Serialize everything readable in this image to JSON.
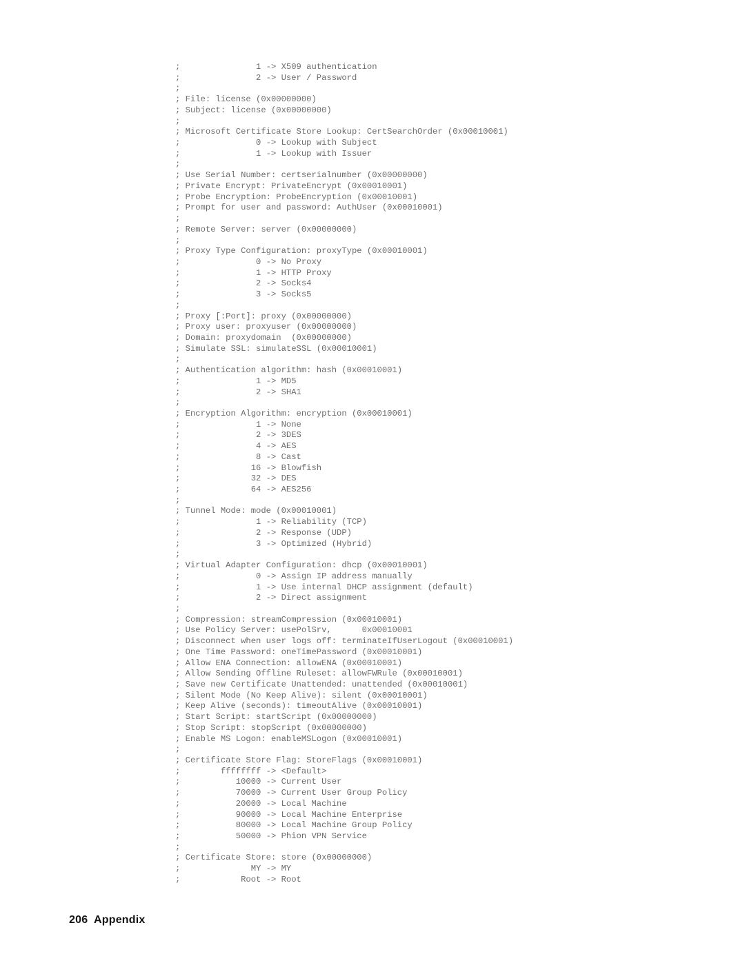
{
  "document": {
    "page_number": "206",
    "section_label": "Appendix",
    "footer_text": "206  Appendix",
    "text_color": "#6d6d6d",
    "footer_color": "#141414",
    "background_color": "#ffffff"
  },
  "listing": {
    "lines": [
      ";               1 -> X509 authentication",
      ";               2 -> User / Password",
      ";",
      "; File: license (0x00000000)",
      "; Subject: license (0x00000000)",
      ";",
      "; Microsoft Certificate Store Lookup: CertSearchOrder (0x00010001)",
      ";               0 -> Lookup with Subject",
      ";               1 -> Lookup with Issuer",
      ";",
      "; Use Serial Number: certserialnumber (0x00000000)",
      "; Private Encrypt: PrivateEncrypt (0x00010001)",
      "; Probe Encryption: ProbeEncryption (0x00010001)",
      "; Prompt for user and password: AuthUser (0x00010001)",
      ";",
      "; Remote Server: server (0x00000000)",
      ";",
      "; Proxy Type Configuration: proxyType (0x00010001)",
      ";               0 -> No Proxy",
      ";               1 -> HTTP Proxy",
      ";               2 -> Socks4",
      ";               3 -> Socks5",
      ";",
      "; Proxy [:Port]: proxy (0x00000000)",
      "; Proxy user: proxyuser (0x00000000)",
      "; Domain: proxydomain  (0x00000000)",
      "; Simulate SSL: simulateSSL (0x00010001)",
      ";",
      "; Authentication algorithm: hash (0x00010001)",
      ";               1 -> MD5",
      ";               2 -> SHA1",
      ";",
      "; Encryption Algorithm: encryption (0x00010001)",
      ";               1 -> None",
      ";               2 -> 3DES",
      ";               4 -> AES",
      ";               8 -> Cast",
      ";              16 -> Blowfish",
      ";              32 -> DES",
      ";              64 -> AES256",
      ";",
      "; Tunnel Mode: mode (0x00010001)",
      ";               1 -> Reliability (TCP)",
      ";               2 -> Response (UDP)",
      ";               3 -> Optimized (Hybrid)",
      ";",
      "; Virtual Adapter Configuration: dhcp (0x00010001)",
      ";               0 -> Assign IP address manually",
      ";               1 -> Use internal DHCP assignment (default)",
      ";               2 -> Direct assignment",
      ";",
      "; Compression: streamCompression (0x00010001)",
      "; Use Policy Server: usePolSrv,      0x00010001",
      "; Disconnect when user logs off: terminateIfUserLogout (0x00010001)",
      "; One Time Password: oneTimePassword (0x00010001)",
      "; Allow ENA Connection: allowENA (0x00010001)",
      "; Allow Sending Offline Ruleset: allowFWRule (0x00010001)",
      "; Save new Certificate Unattended: unattended (0x00010001)",
      "; Silent Mode (No Keep Alive): silent (0x00010001)",
      "; Keep Alive (seconds): timeoutAlive (0x00010001)",
      "; Start Script: startScript (0x00000000)",
      "; Stop Script: stopScript (0x00000000)",
      "; Enable MS Logon: enableMSLogon (0x00010001)",
      ";",
      "; Certificate Store Flag: StoreFlags (0x00010001)",
      ";        ffffffff -> <Default>",
      ";           10000 -> Current User",
      ";           70000 -> Current User Group Policy",
      ";           20000 -> Local Machine",
      ";           90000 -> Local Machine Enterprise",
      ";           80000 -> Local Machine Group Policy",
      ";           50000 -> Phion VPN Service",
      ";",
      "; Certificate Store: store (0x00000000)",
      ";              MY -> MY",
      ";            Root -> Root"
    ]
  }
}
